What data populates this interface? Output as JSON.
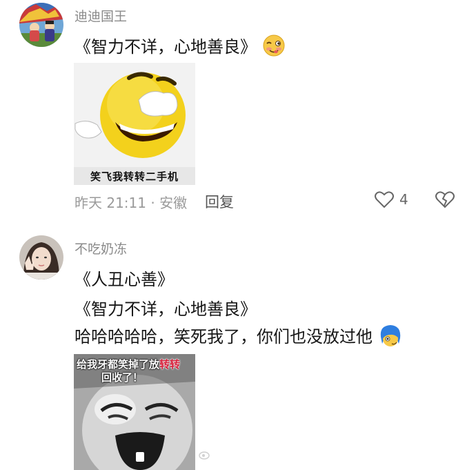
{
  "comment1": {
    "username": "迪迪国王",
    "text": "《智力不详，心地善良》",
    "emoji_icon": "wink-tongue-emoji-icon",
    "image_caption": "笑飞我转转二手机",
    "time_location": "昨天 21:11 · 安徽",
    "reply_label": "回复",
    "like_count": "4"
  },
  "comment2": {
    "username": "不吃奶冻",
    "lines": [
      "《人丑心善》",
      "《智力不详，心地善良》",
      "哈哈哈哈哈，笑死我了，你们也没放过他"
    ],
    "emoji_icon": "blue-hair-face-emoji-icon",
    "image_text_line1_a": "给我牙都笑掉了放",
    "image_text_line1_b": "转转",
    "image_text_line2": "回收了！"
  },
  "colors": {
    "username": "#8a8a8a",
    "meta": "#9a9a9a",
    "highlight": "#d81e3a"
  }
}
